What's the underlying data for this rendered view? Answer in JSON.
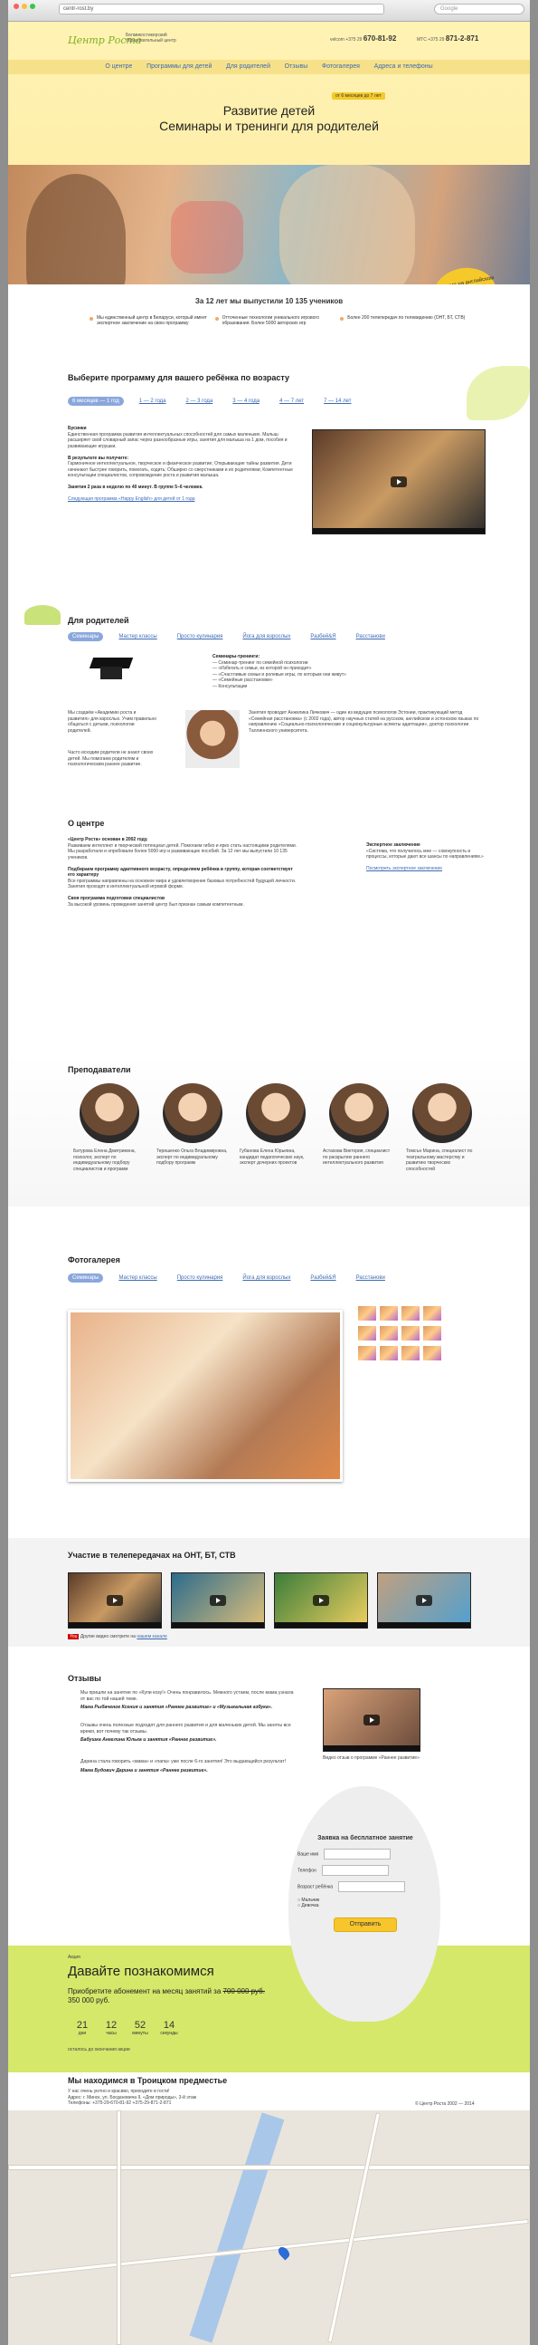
{
  "browser": {
    "url": "centr-rost.by",
    "search_placeholder": "Google"
  },
  "header": {
    "logo": "Центр Роста",
    "logo_sub": "Белмикостикерский образовательный центр",
    "phone1_label": "velcom +375 29",
    "phone1": "670-81-92",
    "phone2_label": "МТС +375 29",
    "phone2": "871-2-871",
    "menu": [
      "О центре",
      "Программы для детей",
      "Для родителей",
      "Отзывы",
      "Фотогалерея",
      "Адреса и телефоны"
    ]
  },
  "hero": {
    "line1": "Развитие детей",
    "line2": "Семинары и тренинги для родителей",
    "badge": "от 6 месяцев до 7 лет",
    "english": "Обучение на английском и русском языках"
  },
  "stats": {
    "headline": "За 12 лет мы выпустили 10 135 учеников",
    "items": [
      "Мы единственный центр в Беларуси, который имеет экспертное заключение на свою программу",
      "Отточенные технологии уникального игрового образования. Более 5000 авторских игр",
      "Более 200 телепередач по телевидению (ОНТ, БТ, СТВ)"
    ]
  },
  "programs": {
    "title": "Выберите программу для вашего ребёнка по возрасту",
    "tabs": [
      "6 месяцев — 1 год",
      "1 — 2 года",
      "2 — 3 года",
      "3 — 4 года",
      "4 — 7 лет",
      "7 — 14 лет"
    ],
    "name": "Бусинки",
    "desc": "Единственная программа развития интеллектуальных способностей для самых маленьких. Малыш расширяет свой словарный запас через разнообразные игры, занятия для малыша на 1 дом, пособия и развивающие игрушки.",
    "result_title": "В результате вы получите:",
    "result": "Гармоничное интеллектуальное, творческое и физическое развитие; Открывающие тайны развития. Дети начинают быстрее говорить, помогать, ходить; Обширно со сверстниками и их родителями; Компетентные консультации специалистов, сопровождение роста и развития малыша.",
    "lessons": "Занятия 2 раза в неделю по 40 минут. В группе 5–6 человек.",
    "next_link": "Следующая программа «Happy English» для детей от 1 года"
  },
  "parents": {
    "title": "Для родителей",
    "tabs": [
      "Семинары",
      "Мастер классы",
      "Просто кулинария",
      "Йога для взрослых",
      "Разбей&Я",
      "Расстанови"
    ],
    "seminars_title": "Семинары-тренинги:",
    "seminars": [
      "— Семинар-тренинг по семейной психологии",
      "— «Избегать и семьи, из которой он приходит»",
      "— «Счастливые семьи и ролевые игры, по которым они живут»",
      "— «Семейные расстановки»",
      "— Консультации"
    ],
    "left_note": "Мы создаём «Академию роста и развития» для взрослых. Учим правильно общаться с детьми, психологии родителей.",
    "left_note2": "Часто исходим родители не знают своих детей. Мы помогаем родителям и психологическим раннее развитие.",
    "author": "Занятия проводит Анжелика Личкович — один из ведущих психологов Эстонии, практикующий метод «Семейная расстановка» (с 2002 года), автор научных статей на русском, английском и эстонском языках по направлению «Социально-психологические и социокультурные аспекты адаптации», доктор психологии Таллиннского университета."
  },
  "about": {
    "title": "О центре",
    "p1_head": "«Центр Роста» основан в 2002 году.",
    "p1": "Развиваем интеллект и творческий потенциал детей. Помогаем гибко и ярко стать настоящими родителями. Мы разработали и опробовали более 5000 игр и развивающих пособий. За 12 лет мы выпустили 10 135 учеников.",
    "p2_head": "Подбираем программу адаптивного возрасту, определяем ребёнка в группу, которая соответствует его характеру",
    "p2": "Все программы направлены на основное мира и удовлетворение базовых потребностей будущей личности. Занятия проходят в интеллектуальной игровой форме.",
    "p3_head": "Своя программа подготовки специалистов",
    "p3": "За высокой уровень проведения занятий центр был признан самым компетентным.",
    "expert_title": "Экспертное заключение",
    "expert": "«Система, что получилось мне — совокупность и процессы, которые дают все шансы по направлениям.»",
    "expert_link": "Посмотреть экспертное заключение"
  },
  "teachers": {
    "title": "Преподаватели",
    "list": [
      "Батурова Елена Дмитриевна, психолог, эксперт по индивидуальному подбору специалистов и программ",
      "Терешенко Ольга Владимировна, эксперт по индивидуальному подбору программ",
      "Губанова Елена Юрьевна, кандидат педагогических наук, эксперт дочерних проектов",
      "Астахова Виктория, специалист по раскрытию раннего интеллектуального развития",
      "Томсън Марина, специалист по театральному мастерству и развитию творческих способностей"
    ]
  },
  "gallery": {
    "title": "Фотогалерея",
    "tabs": [
      "Семинары",
      "Мастер классы",
      "Просто кулинария",
      "Йога для взрослых",
      "Разбей&Я",
      "Расстанови"
    ]
  },
  "tv": {
    "title": "Участие в телепередачах на ОНТ, БТ, СТВ",
    "more": "Другие видео смотрите на",
    "more_link": "нашем канале"
  },
  "reviews": {
    "title": "Отзывы",
    "items": [
      {
        "text": "Мы пришли на занятие по «Купи козу!» Очень понравилось. Межного устаем, после мама узнала от вас по той нашей теме.",
        "author": "Мама Рыбаченок Ксения и занятия «Раннее развитие» и «Музыкальная азбука»."
      },
      {
        "text": "Отзывы очень полезные подходят для раннего развития и для маленьких детей. Мы заняты все время, вот почему так отзывы.",
        "author": "Бабушка Ангелина Юлька и занятия «Раннее развитие»."
      },
      {
        "text": "Дарина стала говорить «мама» и «папа» уже после 6-го занятия! Это выдающийся результат!",
        "author": "Мама Будович Дарина и занятия «Раннее развитие»."
      }
    ],
    "video_caption": "Видео отзыв о программе «Раннее развитие»"
  },
  "promo": {
    "label": "Акция",
    "title": "Давайте познакомимся",
    "sub": "Приобретите абонемент на месяц занятий за",
    "old_price": "700 000 руб.",
    "new_price": "350 000 руб.",
    "countdown": [
      {
        "v": "21",
        "u": "дни"
      },
      {
        "v": "12",
        "u": "часы"
      },
      {
        "v": "52",
        "u": "минуты"
      },
      {
        "v": "14",
        "u": "секунды"
      }
    ],
    "countdown_note": "осталось до окончания акции"
  },
  "form": {
    "title": "Заявка на бесплатное занятие",
    "name": "Ваше имя",
    "phone": "Телефон",
    "age": "Возраст ребёнка",
    "male": "Мальчик",
    "female": "Девочка",
    "submit": "Отправить"
  },
  "contacts": {
    "title": "Мы находимся в Троицком предместье",
    "line1": "У нас очень уютно и красиво, приходите в гости!",
    "address": "Адрес: г. Минск, ул. Богдановича 9, «Дом природы», 3-й этаж",
    "phones": "Телефоны: +375-29-670-81-92   +375-29-871-2-871",
    "copyright": "© Центр Роста 2002 — 2014"
  }
}
